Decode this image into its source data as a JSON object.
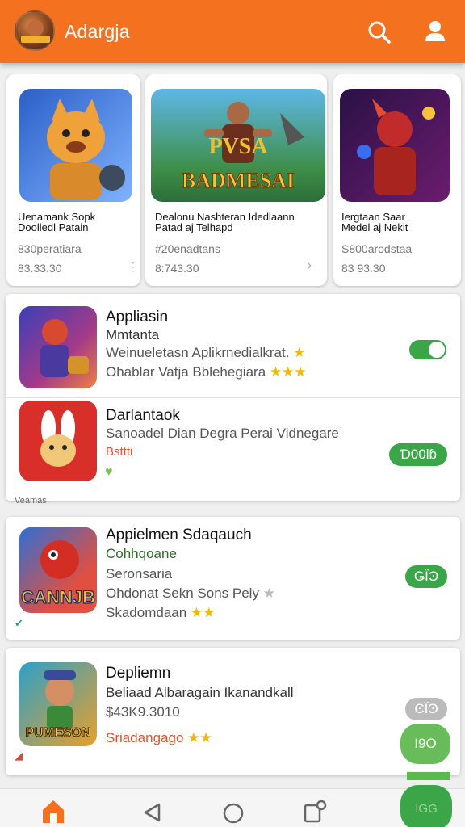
{
  "app": {
    "title": "Adargja"
  },
  "icons": {
    "search": "search-icon",
    "profile": "profile-icon",
    "home": "home-icon",
    "back": "back-icon",
    "circle": "home-circle-icon",
    "recents": "recents-icon",
    "heart": "heart-icon"
  },
  "colors": {
    "accent": "#f4721f",
    "green": "#3aa648",
    "star": "#f2b800"
  },
  "featured": [
    {
      "title_line1": "Uenamank Sopk",
      "title_line2": "Doolledl Patain",
      "subtitle": "830peratiara",
      "price": "83.33.30",
      "more": "⋮"
    },
    {
      "title_line1": "Dealonu Nashteran Idedlaann",
      "title_line2": "Patad aj Telhapd",
      "subtitle": "#20enadtans",
      "price": "8:743.30",
      "more": "›",
      "banner_text": "BADMESAI",
      "banner_top": "PVSA"
    },
    {
      "title_line1": "Iergtaan Saar",
      "title_line2": "Medel aj Nekit",
      "subtitle": "S800arodstaa",
      "price": "83 93.30"
    }
  ],
  "list": [
    {
      "title": "Appliasin",
      "line1": "Mmtanta",
      "line2": "Weinueletasn Aplikrnedialkrat.",
      "line3": "Ohablar Vatja Bblehegiara",
      "stars_line2": "★",
      "stars_line3": "★★★"
    },
    {
      "title": "Darlantaok",
      "line1": "Sanoadel Dian Degra Perai Vidnegare",
      "line2": "Bsttti",
      "pill": "Ɗ00lɓ"
    },
    {
      "title": "Appielmen Sdaqauch",
      "line1": "Cohhqoane",
      "line2": "Seronsaria",
      "line3": "Ohdonat Sekn Sons Pely",
      "line4": "Skadomdaan",
      "stars_line3": "★",
      "stars_line4": "★★",
      "pill": "ǤЇϿ",
      "icon_text": "CANNJB"
    },
    {
      "title": "Depliemn",
      "line1": "Beliaad Albaragain Ikanandkall",
      "line2": "$43K9.3010",
      "line3": "Sriadangago",
      "stars_line3": "★★",
      "pill": "ϾЇϿ",
      "icon_text": "PUMESON"
    }
  ],
  "side_label": "Veamas",
  "fabs": {
    "fab1": "I9O",
    "fab2": "IGG"
  }
}
